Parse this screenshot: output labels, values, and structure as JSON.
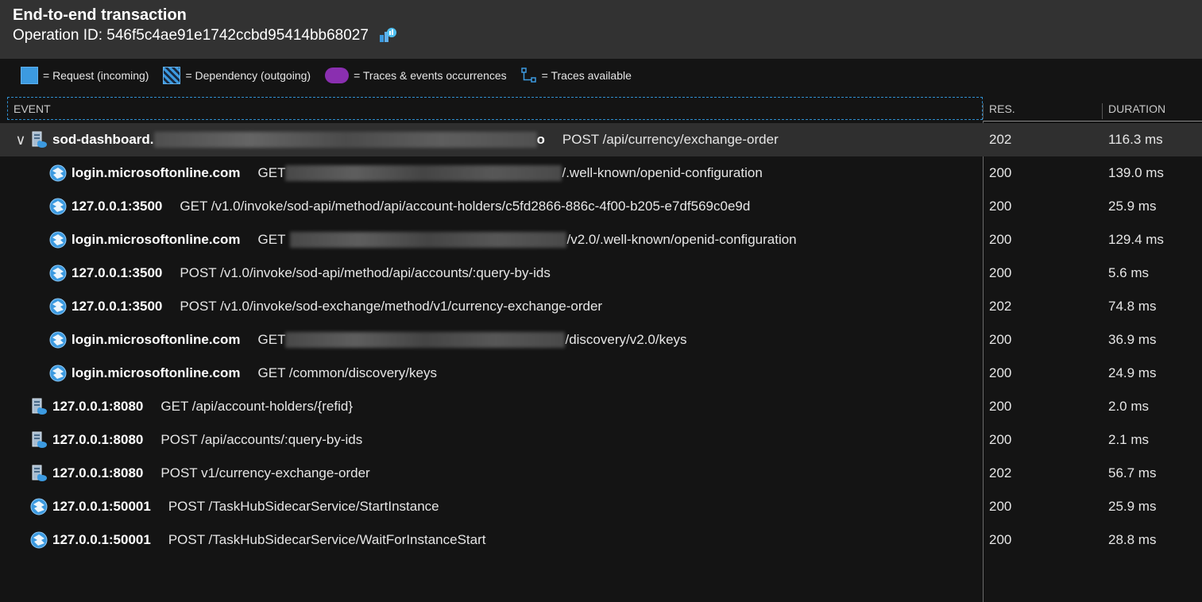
{
  "header": {
    "title": "End-to-end transaction",
    "operation_label": "Operation ID: 546f5c4ae91e1742ccbd95414bb68027"
  },
  "legend": {
    "request": "= Request (incoming)",
    "dependency": "= Dependency (outgoing)",
    "traces": "= Traces & events occurrences",
    "available": "= Traces available"
  },
  "columns": {
    "event": "EVENT",
    "res": "RES.",
    "duration": "DURATION"
  },
  "rows": [
    {
      "kind": "request",
      "indent": 1,
      "expanded": true,
      "host": "sod-dashboard.",
      "host_tail": "o",
      "op": "POST /api/currency/exchange-order",
      "res": "202",
      "dur": "116.3 ms"
    },
    {
      "kind": "dependency",
      "indent": 2,
      "host": "login.microsoftonline.com",
      "op_pre": "GET",
      "op": "/.well-known/openid-configuration",
      "res": "200",
      "dur": "139.0 ms"
    },
    {
      "kind": "dependency",
      "indent": 2,
      "host": "127.0.0.1:3500",
      "op": "GET /v1.0/invoke/sod-api/method/api/account-holders/c5fd2866-886c-4f00-b205-e7df569c0e9d",
      "res": "200",
      "dur": "25.9 ms"
    },
    {
      "kind": "dependency",
      "indent": 2,
      "host": "login.microsoftonline.com",
      "op_pre": "GET",
      "op": "/v2.0/.well-known/openid-configuration",
      "res": "200",
      "dur": "129.4 ms"
    },
    {
      "kind": "dependency",
      "indent": 2,
      "host": "127.0.0.1:3500",
      "op": "POST /v1.0/invoke/sod-api/method/api/accounts/:query-by-ids",
      "res": "200",
      "dur": "5.6 ms"
    },
    {
      "kind": "dependency",
      "indent": 2,
      "host": "127.0.0.1:3500",
      "op": "POST /v1.0/invoke/sod-exchange/method/v1/currency-exchange-order",
      "res": "202",
      "dur": "74.8 ms"
    },
    {
      "kind": "dependency",
      "indent": 2,
      "host": "login.microsoftonline.com",
      "op_pre": "GET",
      "op": "/discovery/v2.0/keys",
      "res": "200",
      "dur": "36.9 ms"
    },
    {
      "kind": "dependency",
      "indent": 2,
      "host": "login.microsoftonline.com",
      "op": "GET /common/discovery/keys",
      "res": "200",
      "dur": "24.9 ms"
    },
    {
      "kind": "request",
      "indent": 1,
      "host": "127.0.0.1:8080",
      "op": "GET /api/account-holders/{refid}",
      "res": "200",
      "dur": "2.0 ms"
    },
    {
      "kind": "request",
      "indent": 1,
      "host": "127.0.0.1:8080",
      "op": "POST /api/accounts/:query-by-ids",
      "res": "200",
      "dur": "2.1 ms"
    },
    {
      "kind": "request",
      "indent": 1,
      "host": "127.0.0.1:8080",
      "op": "POST v1/currency-exchange-order",
      "res": "202",
      "dur": "56.7 ms"
    },
    {
      "kind": "dependency",
      "indent": 1,
      "host": "127.0.0.1:50001",
      "op": "POST /TaskHubSidecarService/StartInstance",
      "res": "200",
      "dur": "25.9 ms"
    },
    {
      "kind": "dependency",
      "indent": 1,
      "host": "127.0.0.1:50001",
      "op": "POST /TaskHubSidecarService/WaitForInstanceStart",
      "res": "200",
      "dur": "28.8 ms"
    }
  ]
}
